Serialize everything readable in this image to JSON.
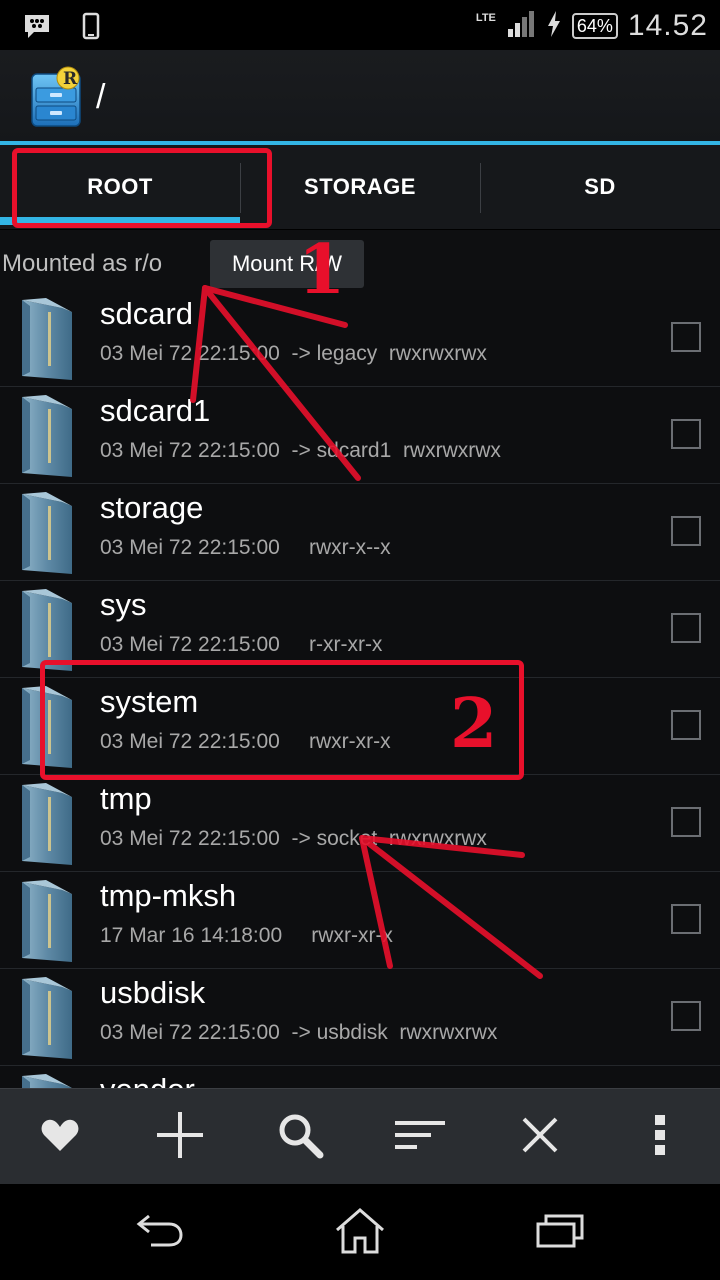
{
  "status_bar": {
    "time": "14.52",
    "battery": "64%",
    "network": "LTE"
  },
  "header": {
    "path": "/"
  },
  "tabs": [
    {
      "label": "ROOT",
      "active": true
    },
    {
      "label": "STORAGE",
      "active": false
    },
    {
      "label": "SD",
      "active": false
    }
  ],
  "mount": {
    "status": "Mounted as r/o",
    "button_label": "Mount R/W"
  },
  "files": [
    {
      "name": "sdcard",
      "meta": "03 Mei 72 22:15:00  -> legacy  rwxrwxrwx"
    },
    {
      "name": "sdcard1",
      "meta": "03 Mei 72 22:15:00  -> sdcard1  rwxrwxrwx"
    },
    {
      "name": "storage",
      "meta": "03 Mei 72 22:15:00     rwxr-x--x"
    },
    {
      "name": "sys",
      "meta": "03 Mei 72 22:15:00     r-xr-xr-x"
    },
    {
      "name": "system",
      "meta": "03 Mei 72 22:15:00     rwxr-xr-x"
    },
    {
      "name": "tmp",
      "meta": "03 Mei 72 22:15:00  -> socket  rwxrwxrwx"
    },
    {
      "name": "tmp-mksh",
      "meta": "17 Mar 16 14:18:00     rwxr-xr-x"
    },
    {
      "name": "usbdisk",
      "meta": "03 Mei 72 22:15:00  -> usbdisk  rwxrwxrwx"
    },
    {
      "name": "vendor",
      "meta": ""
    }
  ],
  "annotations": {
    "step1": "1",
    "step2": "2"
  },
  "colors": {
    "accent": "#33b5e5",
    "annotation": "#e8102b"
  }
}
